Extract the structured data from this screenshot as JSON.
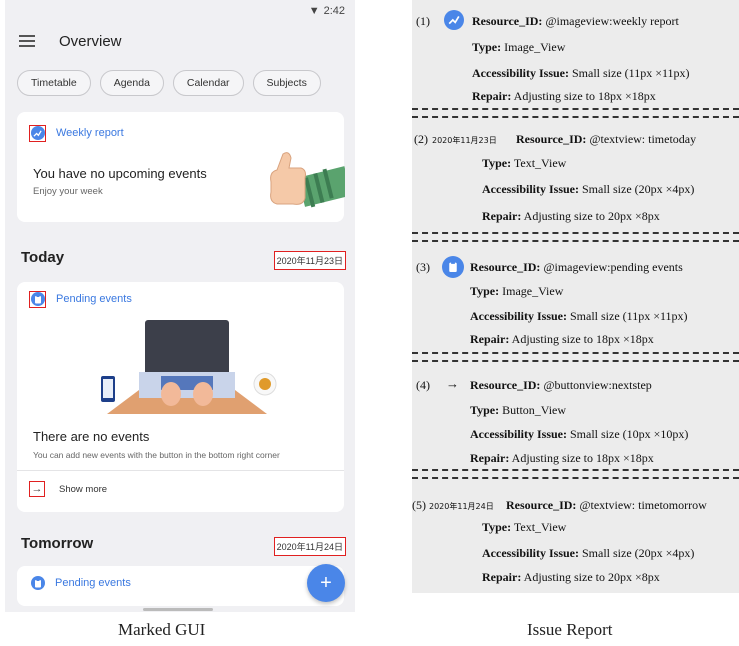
{
  "phone": {
    "time": "2:42",
    "title": "Overview",
    "chips": [
      "Timetable",
      "Agenda",
      "Calendar",
      "Subjects"
    ],
    "card1": {
      "title": "Weekly report",
      "heading": "You have no upcoming events",
      "sub": "Enjoy your week"
    },
    "today": {
      "label": "Today",
      "date": "2020年11月23日"
    },
    "card2": {
      "title": "Pending events",
      "heading": "There are no events",
      "sub": "You can add new events with the button in the bottom right corner",
      "more": "Show more"
    },
    "tomorrow": {
      "label": "Tomorrow",
      "date": "2020年11月24日"
    },
    "card3": {
      "title": "Pending events"
    },
    "fab": "+"
  },
  "captions": {
    "left": "Marked GUI",
    "right": "Issue Report"
  },
  "report": {
    "labels": {
      "rid": "Resource_ID:",
      "type": "Type:",
      "issue": "Accessibility Issue:",
      "repair": "Repair:"
    },
    "issues": [
      {
        "num": "(1)",
        "rid": "@imageview:weekly report",
        "type": "Image_View",
        "issue": "Small size (11px ×11px)",
        "repair": "Adjusting size to 18px ×18px"
      },
      {
        "num": "(2)",
        "date": "2020年11月23日",
        "rid": "@textview: timetoday",
        "type": "Text_View",
        "issue": "Small size (20px ×4px)",
        "repair": "Adjusting size to 20px ×8px"
      },
      {
        "num": "(3)",
        "rid": "@imageview:pending events",
        "type": "Image_View",
        "issue": "Small size (11px ×11px)",
        "repair": "Adjusting size to 18px ×18px"
      },
      {
        "num": "(4)",
        "rid": "@buttonview:nextstep",
        "type": "Button_View",
        "issue": "Small size (10px ×10px)",
        "repair": "Adjusting size to 18px ×18px"
      },
      {
        "num": "(5)",
        "date": "2020年11月24日",
        "rid": "@textview: timetomorrow",
        "type": "Text_View",
        "issue": "Small size (20px ×4px)",
        "repair": "Adjusting size to 20px ×8px"
      }
    ]
  }
}
